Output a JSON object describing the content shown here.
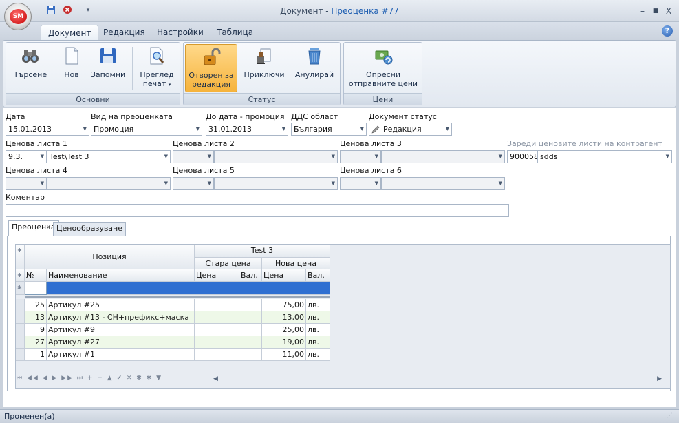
{
  "window": {
    "app_badge": "SM",
    "title_prefix": "Документ - ",
    "title_doc": "Преоценка #77",
    "controls": [
      "–",
      "■",
      "X"
    ],
    "help": "?"
  },
  "ribbon_tabs": [
    "Документ",
    "Редакция",
    "Настройки",
    "Таблица"
  ],
  "ribbon": {
    "groups": [
      {
        "label": "Основни"
      },
      {
        "label": "Статус"
      },
      {
        "label": "Цени"
      }
    ],
    "buttons": {
      "search": "Търсене",
      "new": "Нов",
      "save": "Запомни",
      "preview_line1": "Преглед",
      "preview_line2": "печат",
      "open_line1": "Отворен за",
      "open_line2": "редакция",
      "finish": "Приключи",
      "cancel": "Анулирай",
      "refresh_line1": "Опресни",
      "refresh_line2": "отправните цени"
    }
  },
  "form": {
    "date_label": "Дата",
    "date_value": "15.01.2013",
    "type_label": "Вид на преоценката",
    "type_value": "Промоция",
    "until_label": "До дата - промоция",
    "until_value": "31.01.2013",
    "vat_label": "ДДС област",
    "vat_value": "България",
    "status_label": "Документ статус",
    "status_value": "Редакция",
    "pl1_label": "Ценова листа 1",
    "pl1_code": "9.3.",
    "pl1_name": "Test\\Test 3",
    "pl2_label": "Ценова листа 2",
    "pl3_label": "Ценова листа 3",
    "partner_label": "Зареди ценовите листи на контрагент",
    "partner_code": "900058",
    "partner_name": "sdds",
    "pl4_label": "Ценова листа 4",
    "pl5_label": "Ценова листа 5",
    "pl6_label": "Ценова листа 6",
    "comment_label": "Коментар",
    "comment_value": ""
  },
  "tabs": [
    "Преоценка",
    "Ценообразуване"
  ],
  "grid": {
    "band_position": "Позиция",
    "band_pricelist": "Test 3",
    "band_old": "Стара цена",
    "band_new": "Нова цена",
    "col_no": "№",
    "col_name": "Наименование",
    "col_price_old": "Цена",
    "col_cur_old": "Вал.",
    "col_price_new": "Цена",
    "col_cur_new": "Вал.",
    "rows": [
      {
        "no": "25",
        "name": "Артикул #25",
        "price": "75,00",
        "cur": "лв."
      },
      {
        "no": "13",
        "name": "Артикул #13 - СН+префикс+маска",
        "price": "13,00",
        "cur": "лв."
      },
      {
        "no": "9",
        "name": "Артикул #9",
        "price": "25,00",
        "cur": "лв."
      },
      {
        "no": "27",
        "name": "Артикул #27",
        "price": "19,00",
        "cur": "лв."
      },
      {
        "no": "1",
        "name": "Артикул #1",
        "price": "11,00",
        "cur": "лв."
      }
    ]
  },
  "navigator": "⏮ ◀◀ ◀ ▶ ▶▶ ⏭ + − ▲ ✔ ✕ ✱ ✱ ▼",
  "status": "Променен(а)"
}
